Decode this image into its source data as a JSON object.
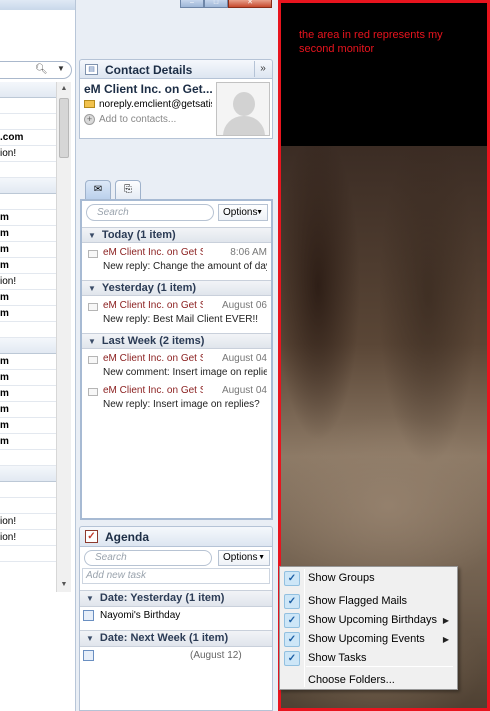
{
  "window": {
    "controls": [
      "–",
      "□",
      "✕"
    ]
  },
  "left_list": {
    "search_icon": "search-icon",
    "rows": [
      {
        "text": "",
        "style": "hdr"
      },
      {
        "text": "",
        "style": ""
      },
      {
        "text": "",
        "style": ""
      },
      {
        "text": ".com",
        "style": "bold"
      },
      {
        "text": "ion!",
        "style": ""
      },
      {
        "text": "",
        "style": ""
      },
      {
        "text": "",
        "style": "hdr"
      },
      {
        "text": "",
        "style": ""
      },
      {
        "text": "m",
        "style": "bold"
      },
      {
        "text": "m",
        "style": "bold"
      },
      {
        "text": "m",
        "style": "bold"
      },
      {
        "text": "m",
        "style": "bold"
      },
      {
        "text": "ion!",
        "style": ""
      },
      {
        "text": "m",
        "style": "bold"
      },
      {
        "text": "m",
        "style": "bold"
      },
      {
        "text": "",
        "style": ""
      },
      {
        "text": "",
        "style": "hdr"
      },
      {
        "text": "m",
        "style": "bold"
      },
      {
        "text": "m",
        "style": "bold"
      },
      {
        "text": "m",
        "style": "bold"
      },
      {
        "text": "m",
        "style": "bold"
      },
      {
        "text": "m",
        "style": "bold"
      },
      {
        "text": "m",
        "style": "bold"
      },
      {
        "text": "",
        "style": ""
      },
      {
        "text": "",
        "style": "hdr"
      },
      {
        "text": "",
        "style": ""
      },
      {
        "text": "",
        "style": ""
      },
      {
        "text": "ion!",
        "style": ""
      },
      {
        "text": "ion!",
        "style": ""
      },
      {
        "text": "",
        "style": ""
      }
    ]
  },
  "contact": {
    "header_title": "Contact Details",
    "collapse_label": "»",
    "name": "eM Client Inc. on Get...",
    "email": "noreply.emclient@getsatis...",
    "add_label": "Add to contacts..."
  },
  "conversations": {
    "search_placeholder": "Search",
    "options_label": "Options",
    "groups": [
      {
        "label": "Today",
        "count": "(1 item)",
        "messages": [
          {
            "from": "eM Client Inc. on Get Satisfa...",
            "time": "8:06 AM",
            "subject": "New reply: Change the amount of days..."
          }
        ]
      },
      {
        "label": "Yesterday",
        "count": "(1 item)",
        "messages": [
          {
            "from": "eM Client Inc. on Get Satis...",
            "time": "August 06",
            "subject": "New reply: Best Mail Client EVER!!"
          }
        ]
      },
      {
        "label": "Last Week",
        "count": "(2 items)",
        "messages": [
          {
            "from": "eM Client Inc. on Get Satis...",
            "time": "August 04",
            "subject": "New comment: Insert image on replies?"
          },
          {
            "from": "eM Client Inc. on Get Satis...",
            "time": "August 04",
            "subject": "New reply: Insert image on replies?"
          }
        ]
      }
    ]
  },
  "agenda": {
    "header_title": "Agenda",
    "search_placeholder": "Search",
    "options_label": "Options",
    "new_task_placeholder": "Add new task",
    "groups": [
      {
        "label": "Date: Yesterday",
        "count": "(1 item)",
        "items": [
          {
            "text": "Nayomi's Birthday",
            "date": ""
          }
        ]
      },
      {
        "label": "Date: Next Week",
        "count": "(1 item)",
        "items": [
          {
            "text": "",
            "date": "(August 12)"
          }
        ]
      }
    ]
  },
  "monitor": {
    "note": "the area in red represents my second monitor",
    "frame_color": "#e8141e"
  },
  "context_menu": {
    "items": [
      {
        "label": "Show Groups",
        "checked": true,
        "submenu": false
      },
      {
        "label": "Show Flagged Mails",
        "checked": true,
        "submenu": false
      },
      {
        "label": "Show Upcoming Birthdays",
        "checked": true,
        "submenu": true
      },
      {
        "label": "Show Upcoming Events",
        "checked": true,
        "submenu": true
      },
      {
        "label": "Show Tasks",
        "checked": true,
        "submenu": false
      },
      {
        "label": "Choose Folders...",
        "checked": false,
        "submenu": false
      }
    ]
  }
}
